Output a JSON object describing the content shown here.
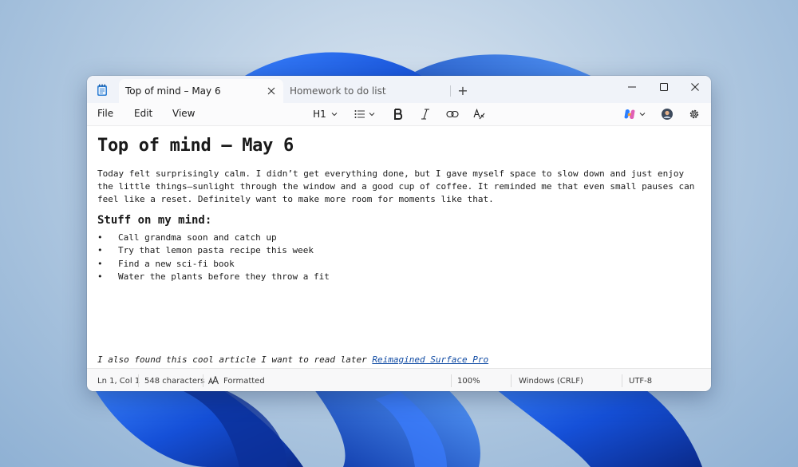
{
  "colors": {
    "accent": "#0f4aa3",
    "wallpaper_bloom": "#1f5fe0"
  },
  "tabs": [
    {
      "label": "Top of mind – May 6",
      "active": true
    },
    {
      "label": "Homework to do list",
      "active": false
    }
  ],
  "titlebar": {
    "new_tab_symbol": "+"
  },
  "menu": {
    "file": "File",
    "edit": "Edit",
    "view": "View"
  },
  "toolbar": {
    "heading_label": "H1",
    "icons": [
      "list-icon",
      "bold-icon",
      "italic-icon",
      "link-icon",
      "clear-formatting-icon",
      "copilot-icon",
      "account-avatar",
      "settings-icon"
    ]
  },
  "document": {
    "title": "Top of mind – May 6",
    "paragraph_lines": [
      "Today felt surprisingly calm. I didn’t get everything done, but I gave myself space to slow down and just enjoy",
      "the little things—sunlight through the window and a good cup of coffee. It reminded me that even small pauses can",
      "feel like a reset. Definitely want to make more room for moments like that."
    ],
    "subheading": "Stuff on my mind:",
    "bullets": [
      "Call grandma soon and catch up",
      "Try that lemon pasta recipe this week",
      "Find a new sci-fi book",
      "Water the plants before they throw a fit"
    ],
    "article_text": "I also found this cool article I want to read later ",
    "article_link": "Reimagined Surface Pro"
  },
  "status": {
    "position": "Ln 1, Col 1",
    "characters": "548 characters",
    "format": "Formatted",
    "zoom": "100%",
    "line_ending": "Windows (CRLF)",
    "encoding": "UTF-8"
  }
}
